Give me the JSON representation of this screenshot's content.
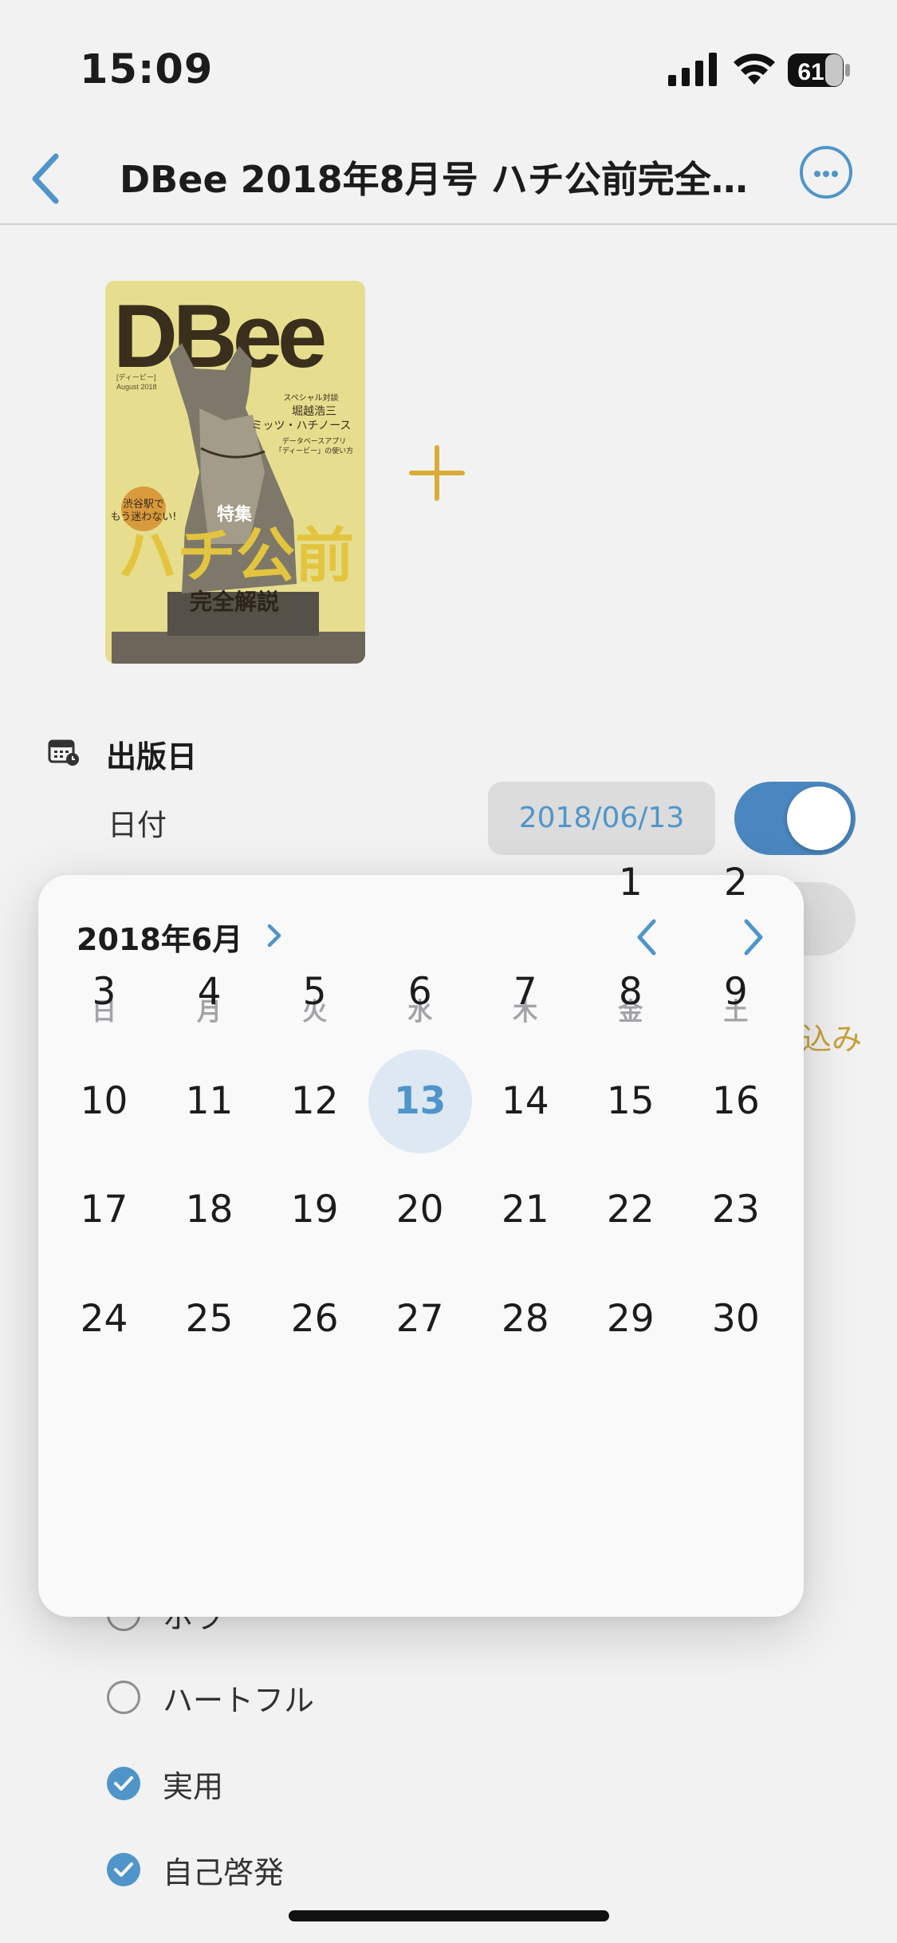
{
  "status_bar": {
    "time": "15:09",
    "battery": "61"
  },
  "nav": {
    "title": "DBee 2018年8月号 ハチ公前完全…",
    "back_icon": "chevron-left-icon",
    "more_icon": "ellipsis-circle-icon"
  },
  "cover": {
    "masthead": "DBee",
    "subtitle_small": "[ディービー]",
    "issue": "August 2018",
    "side_text_1": "スペシャル対談",
    "side_text_2": "堀越浩三",
    "side_text_3": "ミッツ・ハチノース",
    "side_text_4": "データベースアプリ",
    "side_text_5": "「ディービー」の使い方",
    "badge_1": "渋谷駅で",
    "badge_2": "もう迷わない!",
    "feature_label": "特集",
    "feature_title": "ハチ公前",
    "feature_sub": "完全解説"
  },
  "publish": {
    "section_title": "出版日",
    "date_label": "日付",
    "date_value": "2018/06/13",
    "toggle_on": true,
    "side_link": "込み"
  },
  "calendar": {
    "month_label": "2018年6月",
    "weekdays": [
      "日",
      "月",
      "火",
      "水",
      "木",
      "金",
      "土"
    ],
    "first_weekday": 5,
    "days_in_month": 30,
    "selected_day": 13
  },
  "options": [
    {
      "label": "ホラ",
      "checked": false
    },
    {
      "label": "ハートフル",
      "checked": false
    },
    {
      "label": "実用",
      "checked": true
    },
    {
      "label": "自己啓発",
      "checked": true
    }
  ],
  "colors": {
    "accent": "#4f95c9",
    "gold": "#c9a13a",
    "toggle": "#4a86bf"
  }
}
